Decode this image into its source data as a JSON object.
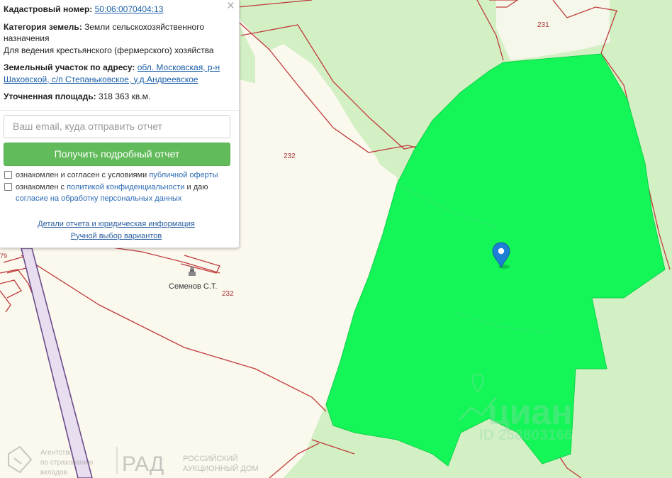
{
  "panel": {
    "close_icon": "×",
    "cadastral_label": "Кадастровый номер:",
    "cadastral_number": "50:06:0070404:13",
    "category_label": "Категория земель:",
    "category_value": "Земли сельскохозяйственного назначения",
    "usage": "Для ведения крестьянского (фермерского) хозяйства",
    "address_label": "Земельный участок по адресу:",
    "address_value": "обл. Московская, р-н Шаховской, с/п Степаньковское, у.д.Андреевское",
    "area_label": "Уточненная площадь:",
    "area_value": "318 363 кв.м.",
    "email_placeholder": "Ваш email, куда отправить отчет",
    "get_report_button": "Получить подробный отчет",
    "agree1_text": "ознакомлен и согласен с условиями",
    "agree1_link": "публичной оферты",
    "agree2_text_a": "ознакомлен с",
    "agree2_link1": "политикой конфиденциальности",
    "agree2_text_b": "и даю",
    "agree2_link2": "согласие на обработку персональных данных",
    "details_link": "Детали отчета и юридическая информация",
    "manual_link": "Ручной выбор вариантов"
  },
  "map": {
    "labels": {
      "parcel_231": "231",
      "parcel_232_a": "232",
      "parcel_232_b": "232",
      "parcel_79": "79",
      "owner": "Семенов С.Т."
    },
    "watermarks": {
      "cian_brand": "циан",
      "cian_id": "ID 258803166",
      "agency_line1": "Агентство",
      "agency_line2": "по страхованию",
      "agency_line3": "вкладов",
      "rad_logo": "РАД",
      "rad_line1": "РОССИЙСКИЙ",
      "rad_line2": "АУКЦИОННЫЙ ДОМ"
    },
    "colors": {
      "highlight_parcel": "#14f558",
      "forest": "#d3f0c4",
      "boundary": "#bf3b3b",
      "marker": "#1e7fd6"
    },
    "icons": {
      "marker": "map-pin-icon",
      "building": "monument-icon"
    }
  }
}
